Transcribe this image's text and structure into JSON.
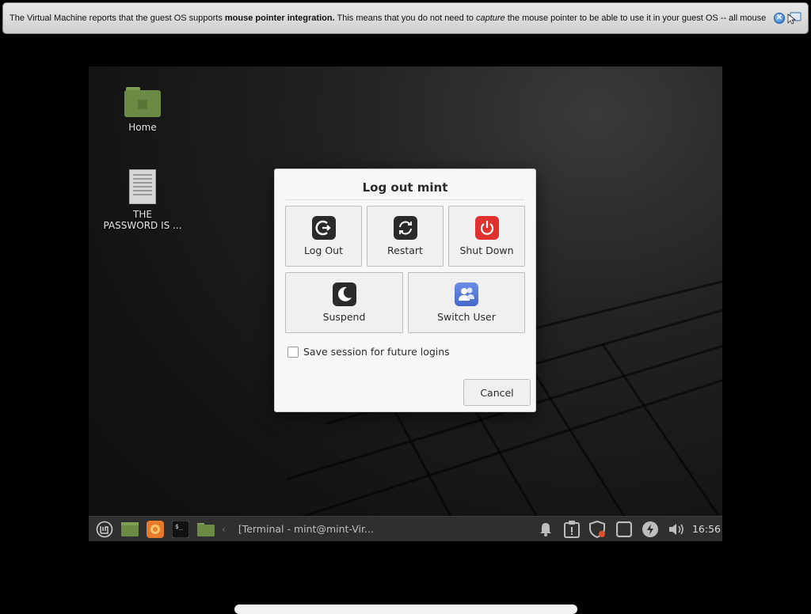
{
  "vm_notice": {
    "prefix": "The Virtual Machine reports that the guest OS supports ",
    "bold": "mouse pointer integration.",
    "middle": " This means that you do not need to ",
    "italic": "capture",
    "suffix": " the mouse pointer to be able to use it in your guest OS -- all mouse",
    "close_symbol": "✕"
  },
  "desktop": {
    "home_label": "Home",
    "file_label_line1": "THE",
    "file_label_line2": "PASSWORD IS ..."
  },
  "dialog": {
    "title": "Log out mint",
    "buttons": {
      "logout": "Log Out",
      "restart": "Restart",
      "shutdown": "Shut Down",
      "suspend": "Suspend",
      "switch_user": "Switch User"
    },
    "save_session_label": "Save session for future logins",
    "save_session_checked": false,
    "cancel": "Cancel"
  },
  "panel": {
    "separator": "‹",
    "task_label": "[Terminal - mint@mint-Vir...",
    "clock": "16:56",
    "icons": [
      "menu-icon",
      "show-desktop-icon",
      "firefox-icon",
      "terminal-icon",
      "files-icon",
      "notifications-icon",
      "update-manager-icon",
      "firewall-icon",
      "workspace-icon",
      "power-icon",
      "volume-icon"
    ]
  }
}
